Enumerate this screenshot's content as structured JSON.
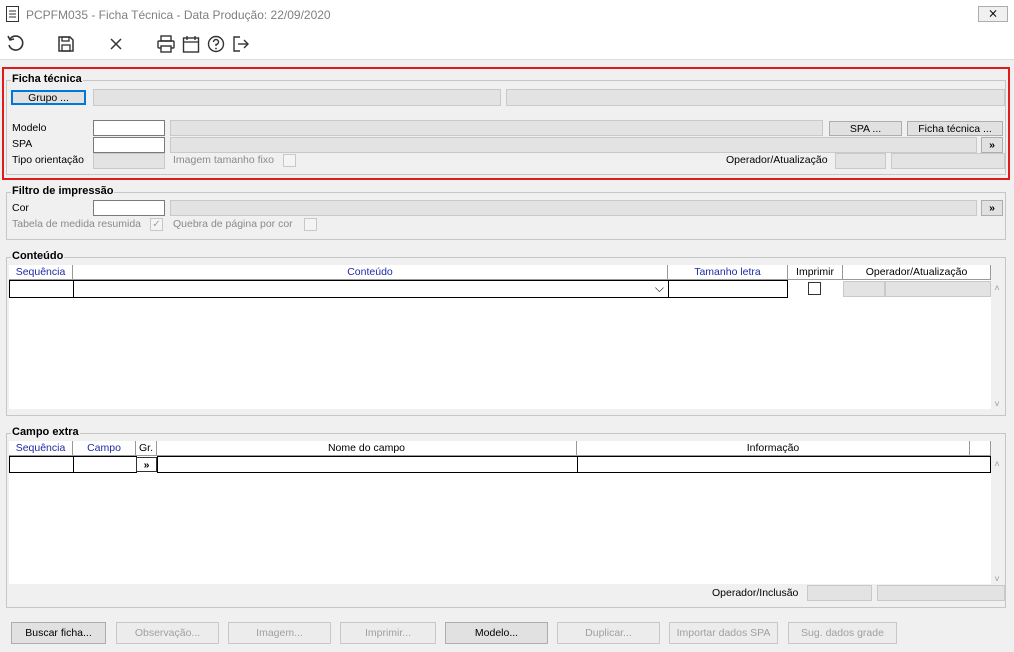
{
  "window": {
    "title": "PCPFM035 - Ficha Técnica - Data Produção: 22/09/2020",
    "close_glyph": "⨯"
  },
  "toolbar": {
    "icons": [
      "refresh-icon",
      "save-icon",
      "cancel-icon",
      "print-icon",
      "calendar-icon",
      "help-icon",
      "exit-icon"
    ]
  },
  "ficha": {
    "legend": "Ficha técnica",
    "grupo_button": "Grupo ...",
    "modelo_label": "Modelo",
    "spa_label": "SPA",
    "tipo_label": "Tipo orientação",
    "imagem_label": "Imagem tamanho fixo",
    "operador_label": "Operador/Atualização",
    "spa_button": "SPA ...",
    "ficha_button": "Ficha técnica ...",
    "more_glyph": "»"
  },
  "filtro": {
    "legend": "Filtro de impressão",
    "cor_label": "Cor",
    "tabela_label": "Tabela de medida resumida",
    "quebra_label": "Quebra de página por cor",
    "more_glyph": "»",
    "check_glyph": "✓"
  },
  "conteudo": {
    "legend": "Conteúdo",
    "columns": [
      "Sequência",
      "Conteúdo",
      "Tamanho letra",
      "Imprimir",
      "Operador/Atualização"
    ],
    "dropdown_glyph": "⌵"
  },
  "campo": {
    "legend": "Campo extra",
    "columns": [
      "Sequência",
      "Campo",
      "Gr.",
      "Nome do campo",
      "Informação"
    ],
    "more_glyph": "»",
    "operador_inclusao_label": "Operador/Inclusão"
  },
  "scroll": {
    "up": "˄",
    "down": "˅"
  },
  "buttons": [
    "Buscar ficha...",
    "Observação...",
    "Imagem...",
    "Imprimir...",
    "Modelo...",
    "Duplicar...",
    "Importar dados SPA",
    "Sug. dados grade"
  ],
  "buttons_enabled": [
    true,
    false,
    false,
    false,
    true,
    false,
    false,
    false
  ]
}
